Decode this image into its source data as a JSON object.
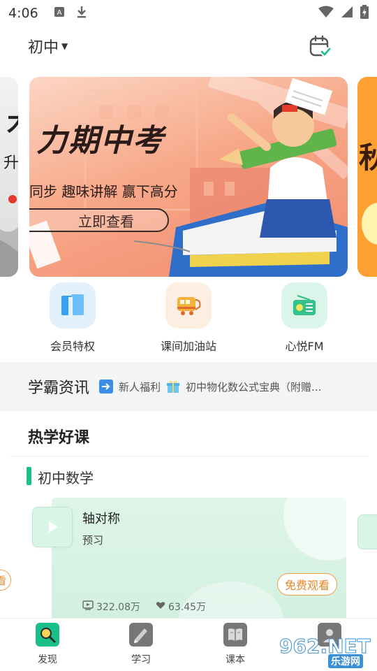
{
  "status_bar": {
    "time": "4:06"
  },
  "header": {
    "grade": "初中"
  },
  "banner": {
    "title": "力期中考",
    "subtitle": "同步  趣味讲解  赢下高分",
    "cta": "立即查看"
  },
  "quick_entries": [
    {
      "label": "会员特权",
      "icon": "book-icon"
    },
    {
      "label": "课间加油站",
      "icon": "bus-icon"
    },
    {
      "label": "心悦FM",
      "icon": "radio-icon"
    }
  ],
  "news": {
    "title": "学霸资讯",
    "ticker": "新人福利",
    "ticker_2": "初中物化数公式宝典（附赠..."
  },
  "hot_courses": {
    "title": "热学好课",
    "subject": "初中数学",
    "course": {
      "name": "轴对称",
      "tag": "预习",
      "button": "免费观看",
      "views": "322.08万",
      "likes": "63.45万"
    },
    "left_peek_label": "看"
  },
  "bottom_nav": [
    {
      "label": "发现",
      "icon": "discover-icon"
    },
    {
      "label": "学习",
      "icon": "study-icon"
    },
    {
      "label": "课本",
      "icon": "textbook-icon"
    }
  ],
  "watermark": {
    "text": "962.NET",
    "sub": "乐游网"
  },
  "colors": {
    "accent_green": "#19c08a",
    "button_orange": "#e8872a",
    "news_bg": "#f3f4f5"
  }
}
